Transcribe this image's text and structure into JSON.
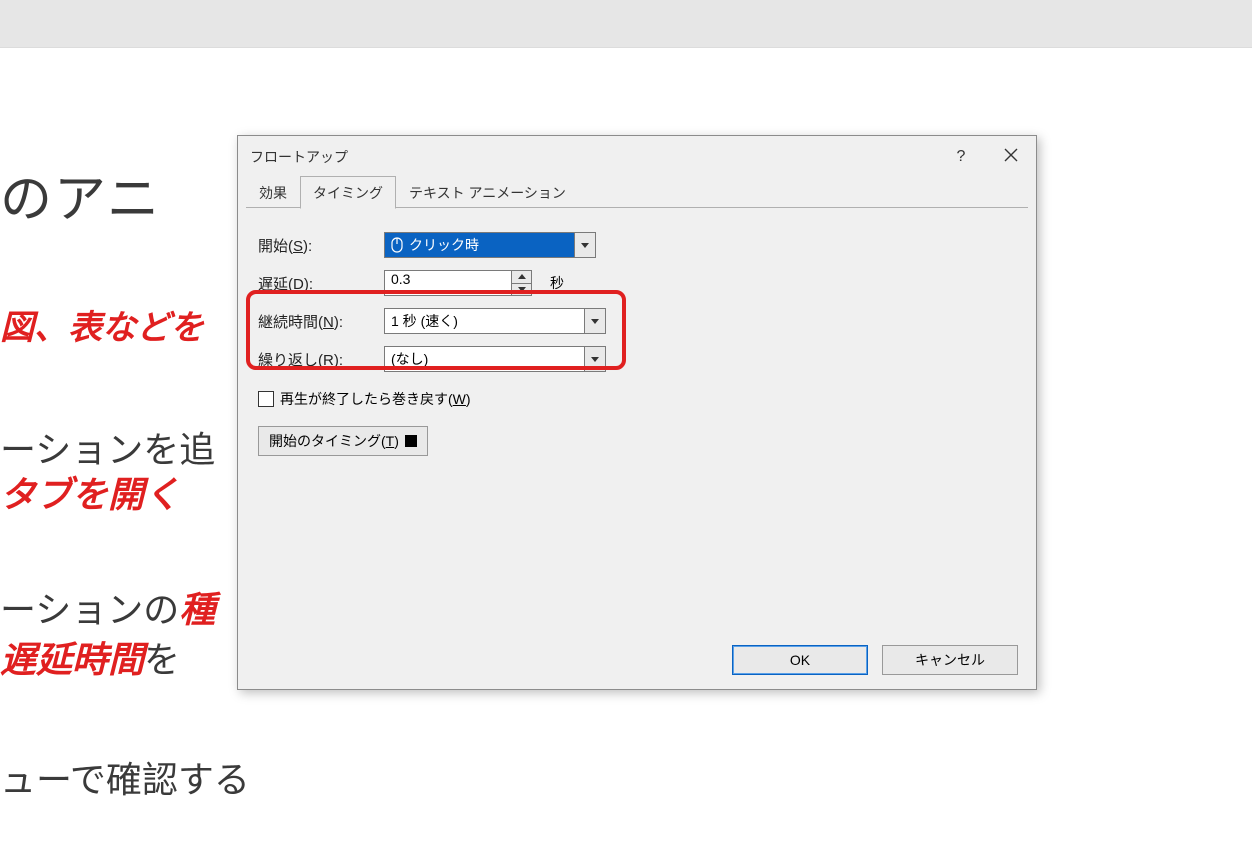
{
  "background": {
    "line1": "のアニ",
    "line2": "図、表などを",
    "line3": "ーションを追",
    "line4": "タブを開く",
    "line5a": "ーションの",
    "line5b": "種",
    "line6a": "遅延時間",
    "line6b": "を",
    "line7": "ューで確認する"
  },
  "dialog": {
    "title": "フロートアップ",
    "help_label": "?",
    "tabs": {
      "effect": "効果",
      "timing": "タイミング",
      "text_anim": "テキスト アニメーション"
    },
    "fields": {
      "start": {
        "label": "開始(",
        "key": "S",
        "label2": "):",
        "value": "クリック時"
      },
      "delay": {
        "label": "遅延(",
        "key": "D",
        "label2": "):",
        "value": "0.3",
        "unit": "秒"
      },
      "duration": {
        "label": "継続時間(",
        "key": "N",
        "label2": "):",
        "value": "1 秒 (速く)"
      },
      "repeat": {
        "label": "繰り返し(",
        "key": "R",
        "label2": "):",
        "value": "(なし)"
      },
      "rewind": {
        "label": "再生が終了したら巻き戻す(",
        "key": "W",
        "label2": ")"
      },
      "start_timing": {
        "label": "開始のタイミング(",
        "key": "T",
        "label2": ")"
      }
    },
    "buttons": {
      "ok": "OK",
      "cancel": "キャンセル"
    }
  }
}
